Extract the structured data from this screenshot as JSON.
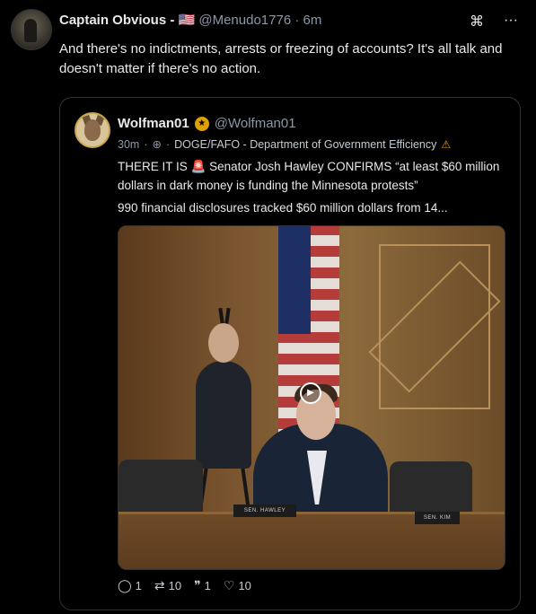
{
  "post": {
    "author_name": "Captain Obvious - 🇺🇸",
    "handle": "@Menudo1776",
    "dot": "·",
    "time": "6m",
    "text": "And there's no indictments, arrests or freezing of accounts? It's all talk and doesn't matter if there's no action.",
    "icons": [
      "command-icon",
      "more-icon"
    ]
  },
  "quote": {
    "author_name": "Wolfman01",
    "handle": "@Wolfman01",
    "time": "30m",
    "community": "DOGE/FAFO - Department of Government Efficiency",
    "text_line1": "THERE IT IS 🚨 Senator Josh Hawley CONFIRMS “at least $60 million dollars in dark money is funding the Minnesota protests”",
    "text_line2": "990 financial disclosures tracked $60 million dollars from 14...",
    "video": {
      "plate_left": "SEN. HAWLEY",
      "plate_right": "SEN. KIM"
    },
    "actions": {
      "replies": "1",
      "reposts": "10",
      "quotes": "1",
      "likes": "10"
    }
  },
  "colors": {
    "background": "#000000",
    "text": "#e7e9ea",
    "muted": "#8b98a5",
    "border": "#2f3336",
    "badge": "#e0a100"
  }
}
